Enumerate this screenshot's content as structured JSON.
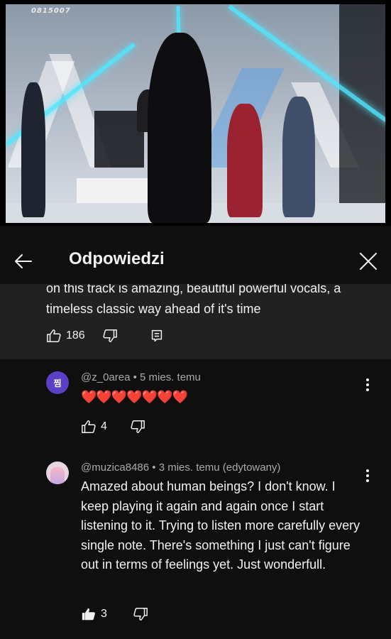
{
  "video": {
    "stamp": "0815007"
  },
  "header": {
    "title": "Odpowiedzi",
    "back_icon": "arrow-left-icon",
    "close_icon": "close-icon"
  },
  "parent_comment": {
    "text_partial": "on this track is amazing, beautiful powerful vocals, a",
    "text": "timeless classic way ahead of it's time",
    "likes": "186"
  },
  "replies": [
    {
      "avatar_text": "찜",
      "avatar_color": "#5b3fc4",
      "author": "@z_0area",
      "meta": "• 5 mies. temu",
      "text": "❤️❤️❤️❤️❤️❤️❤️",
      "likes": "4",
      "liked": false
    },
    {
      "avatar_text": "",
      "avatar_color": "#e9d6e3",
      "author": "@muzica8486",
      "meta": "• 3 mies. temu (edytowany)",
      "text": "Amazed about human beings? I don't know. I keep playing it again and again once I start listening to it. Trying to listen more carefully every single note. There's something I just can't figure out in terms of feelings yet. Just wonderfull.",
      "likes": "3",
      "liked": true
    }
  ]
}
